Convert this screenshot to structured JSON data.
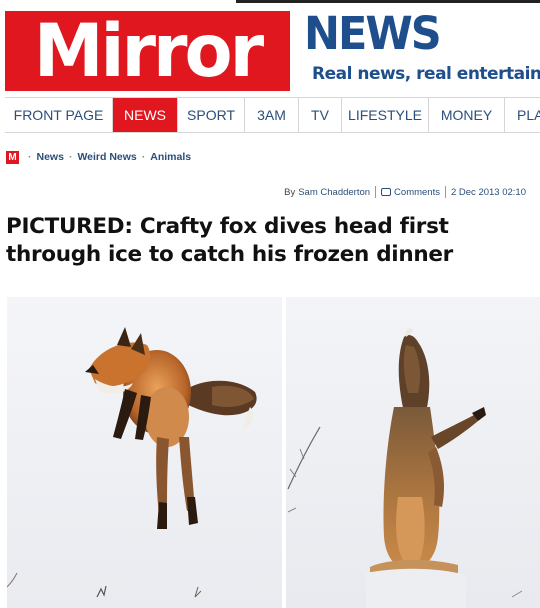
{
  "header": {
    "logo_text": "Mirror",
    "section_title": "NEWS",
    "tagline": "Real news, real entertainment"
  },
  "nav": {
    "items": [
      {
        "label": "FRONT PAGE",
        "active": false
      },
      {
        "label": "NEWS",
        "active": true
      },
      {
        "label": "SPORT",
        "active": false
      },
      {
        "label": "3AM",
        "active": false
      },
      {
        "label": "TV",
        "active": false
      },
      {
        "label": "LIFESTYLE",
        "active": false
      },
      {
        "label": "MONEY",
        "active": false
      },
      {
        "label": "PLA",
        "active": false
      }
    ]
  },
  "breadcrumb": {
    "logo_letter": "M",
    "items": [
      "News",
      "Weird News",
      "Animals"
    ]
  },
  "byline": {
    "by_label": "By",
    "author": "Sam Chadderton",
    "comments_label": "Comments",
    "date": "2 Dec 2013 02:10"
  },
  "article": {
    "headline": "PICTURED: Crafty fox dives head first through ice to catch his frozen dinner"
  },
  "colors": {
    "brand_red": "#e0171e",
    "news_blue": "#1f4e8c",
    "link_blue": "#2b4f7a"
  }
}
